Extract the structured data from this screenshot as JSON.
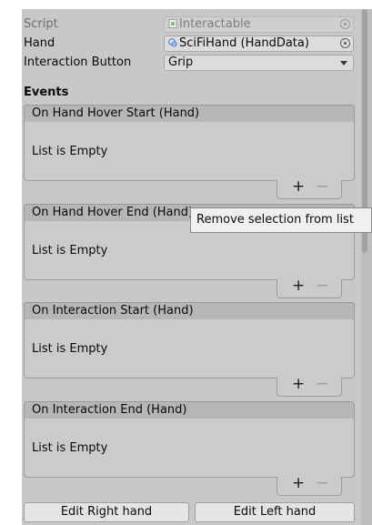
{
  "properties": {
    "script": {
      "label": "Script",
      "value": "Interactable"
    },
    "hand": {
      "label": "Hand",
      "value": "SciFiHand (HandData)"
    },
    "interaction_button": {
      "label": "Interaction Button",
      "value": "Grip"
    }
  },
  "events": {
    "heading": "Events",
    "items": [
      {
        "header": "On Hand Hover Start (Hand)",
        "empty_text": "List is Empty",
        "add": "+",
        "remove": "−"
      },
      {
        "header": "On Hand Hover End (Hand)",
        "empty_text": "List is Empty",
        "add": "+",
        "remove": "−"
      },
      {
        "header": "On Interaction Start (Hand)",
        "empty_text": "List is Empty",
        "add": "+",
        "remove": "−"
      },
      {
        "header": "On Interaction End (Hand)",
        "empty_text": "List is Empty",
        "add": "+",
        "remove": "−"
      }
    ]
  },
  "buttons": {
    "edit_right": "Edit Right hand",
    "edit_left": "Edit Left hand"
  },
  "tooltip": "Remove selection from list",
  "icons": {
    "script": "script-icon",
    "hand": "scriptable-object-icon",
    "picker": "object-picker-icon",
    "dropdown": "dropdown-arrow-icon"
  },
  "colors": {
    "panel": "#c8c8c8",
    "header": "#b6b6b6",
    "tooltip": "#f0f0f0"
  }
}
